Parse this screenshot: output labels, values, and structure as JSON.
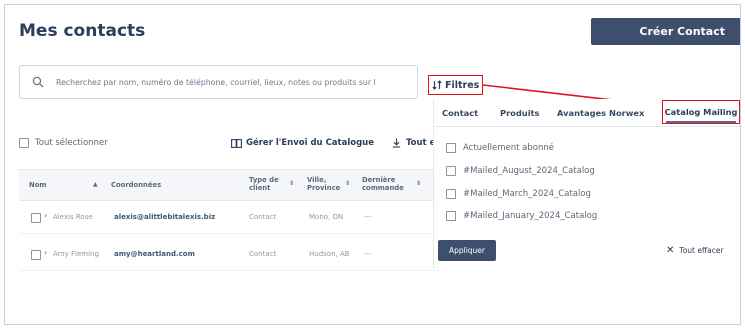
{
  "header": {
    "title": "Mes contacts",
    "create_button": "Créer Contact"
  },
  "search": {
    "placeholder": "Recherchez par nom, numéro de téléphone, courriel, lieux, notes ou produits sur l"
  },
  "filters_button": "Filtres",
  "toolbar": {
    "select_all": "Tout sélectionner",
    "catalog_shipping": "Gérer l'Envoi du Catalogue",
    "export": "Tout e"
  },
  "table": {
    "columns": [
      {
        "line1": "Nom",
        "line2": ""
      },
      {
        "line1": "Coordonnées",
        "line2": ""
      },
      {
        "line1": "Type de",
        "line2": "client"
      },
      {
        "line1": "Ville,",
        "line2": "Province"
      },
      {
        "line1": "Dernière",
        "line2": "commande"
      }
    ],
    "rows": [
      {
        "name": "Alexis Rose",
        "email": "alexis@alittlebitalexis.biz",
        "type": "Contact",
        "city": "Mono, ON",
        "last_order": "---"
      },
      {
        "name": "Amy Fleming",
        "email": "amy@heartland.com",
        "type": "Contact",
        "city": "Hudson, AB",
        "last_order": "---"
      }
    ]
  },
  "filter_panel": {
    "tabs": [
      "Contact",
      "Produits",
      "Avantages Norwex",
      "Catalog Mailing"
    ],
    "active_tab": "Catalog Mailing",
    "options": [
      "Actuellement abonné",
      "#Mailed_August_2024_Catalog",
      "#Mailed_March_2024_Catalog",
      "#Mailed_January_2024_Catalog"
    ],
    "apply_button": "Appliquer",
    "clear_all": "Tout effacer"
  },
  "colors": {
    "primary": "#3d4f6d",
    "highlight": "#e0141f",
    "title": "#2c3e5a"
  }
}
